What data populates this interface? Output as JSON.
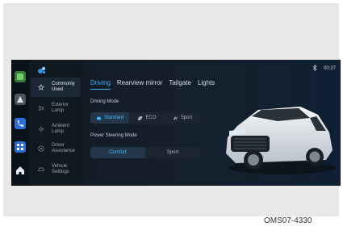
{
  "status": {
    "time": "00:27",
    "bluetooth_icon": "bluetooth-icon"
  },
  "dock": [
    {
      "name": "media-app-icon",
      "color": "#3c7a3c"
    },
    {
      "name": "navigation-icon",
      "color": "#4a5560"
    },
    {
      "name": "phone-icon",
      "color": "#2d6fd6"
    },
    {
      "name": "apps-grid-icon",
      "color": "#2d6fd6"
    },
    {
      "name": "home-icon",
      "color": "#101820"
    }
  ],
  "menu": [
    {
      "label": "Commonly Used",
      "icon": "star-icon",
      "active": true
    },
    {
      "label": "Exterior Lamp",
      "icon": "headlamp-icon",
      "active": false
    },
    {
      "label": "Ambient Lamp",
      "icon": "sun-icon",
      "active": false
    },
    {
      "label": "Driver Assistance",
      "icon": "steering-wheel-icon",
      "active": false
    },
    {
      "label": "Vehicle Settings",
      "icon": "car-icon",
      "active": false
    }
  ],
  "tabs": [
    {
      "label": "Driving",
      "active": true
    },
    {
      "label": "Rearview mirror",
      "active": false
    },
    {
      "label": "Tailgate",
      "active": false
    },
    {
      "label": "Lights",
      "active": false
    }
  ],
  "driving_mode": {
    "title": "Driving Mode",
    "options": [
      {
        "label": "Standard",
        "icon": "standard-mode-icon",
        "active": true
      },
      {
        "label": "ECO",
        "icon": "leaf-icon",
        "active": false
      },
      {
        "label": "Sport",
        "icon": "sport-mode-icon",
        "active": false
      }
    ]
  },
  "power_steering": {
    "title": "Power Steering Mode",
    "options": [
      {
        "label": "Comfort",
        "active": true
      },
      {
        "label": "Sport",
        "active": false
      }
    ]
  },
  "figure_code": "OMS07-4330",
  "accent_color": "#3ab0ff"
}
